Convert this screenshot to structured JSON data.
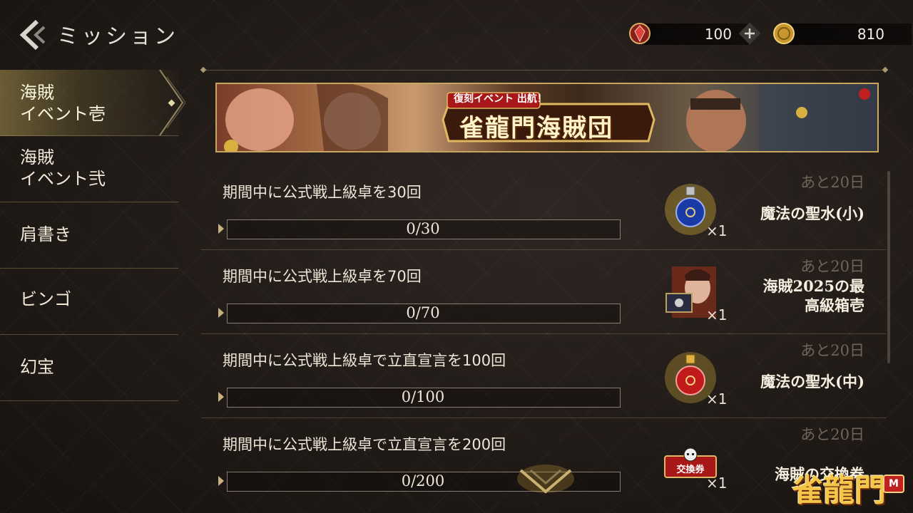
{
  "header": {
    "title": "ミッション",
    "currencies": [
      {
        "name": "jewel-currency",
        "value": "100",
        "has_plus": true
      },
      {
        "name": "coin-currency",
        "value": "810",
        "has_plus": false
      }
    ]
  },
  "sidebar": {
    "items": [
      {
        "label": "海賊\nイベント壱",
        "active": true
      },
      {
        "label": "海賊\nイベント弐",
        "active": false
      },
      {
        "label": "肩書き",
        "active": false
      },
      {
        "label": "ビンゴ",
        "active": false
      },
      {
        "label": "幻宝",
        "active": false
      }
    ]
  },
  "banner": {
    "subtitle": "復刻イベント 出航！",
    "title": "雀龍門海賊団"
  },
  "missions": [
    {
      "title": "期間中に公式戦上級卓を30回",
      "progress": "0/30",
      "fraction": 0,
      "deadline": "あと20日",
      "reward": "魔法の聖水(小)",
      "qty": "×1",
      "reward_icon": "blue-potion-icon"
    },
    {
      "title": "期間中に公式戦上級卓を70回",
      "progress": "0/70",
      "fraction": 0,
      "deadline": "あと20日",
      "reward": "海賊2025の最\n高級箱壱",
      "qty": "×1",
      "reward_icon": "treasure-box-icon"
    },
    {
      "title": "期間中に公式戦上級卓で立直宣言を100回",
      "progress": "0/100",
      "fraction": 0,
      "deadline": "あと20日",
      "reward": "魔法の聖水(中)",
      "qty": "×1",
      "reward_icon": "red-potion-icon"
    },
    {
      "title": "期間中に公式戦上級卓で立直宣言を200回",
      "progress": "0/200",
      "fraction": 0,
      "deadline": "あと20日",
      "reward": "海賊の交換券",
      "qty": "×1",
      "reward_icon": "exchange-ticket-icon",
      "ticket_label": "交換券"
    }
  ],
  "logo": {
    "text": "雀龍門",
    "badge": "M"
  }
}
